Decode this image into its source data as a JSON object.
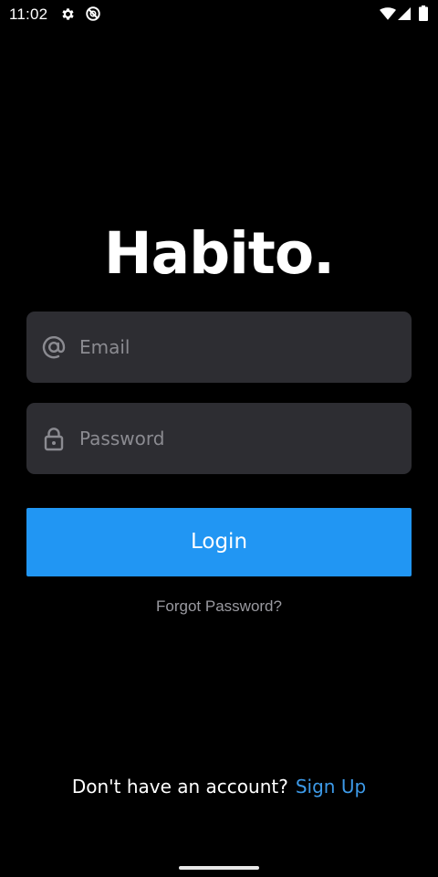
{
  "status_bar": {
    "time": "11:02",
    "icons": [
      "gear-icon",
      "do-not-disturb-icon",
      "wifi-icon",
      "signal-icon",
      "battery-icon"
    ]
  },
  "app": {
    "logo": "Habito."
  },
  "form": {
    "email": {
      "placeholder": "Email",
      "value": "",
      "icon": "at-sign-icon"
    },
    "password": {
      "placeholder": "Password",
      "value": "",
      "icon": "lock-icon"
    },
    "login_label": "Login",
    "forgot_label": "Forgot Password?"
  },
  "footer": {
    "prompt": "Don't have an account?",
    "signup_label": "Sign Up"
  },
  "colors": {
    "background": "#000000",
    "field_bg": "#2d2d32",
    "accent": "#2196f3",
    "link": "#3d9ae8"
  }
}
